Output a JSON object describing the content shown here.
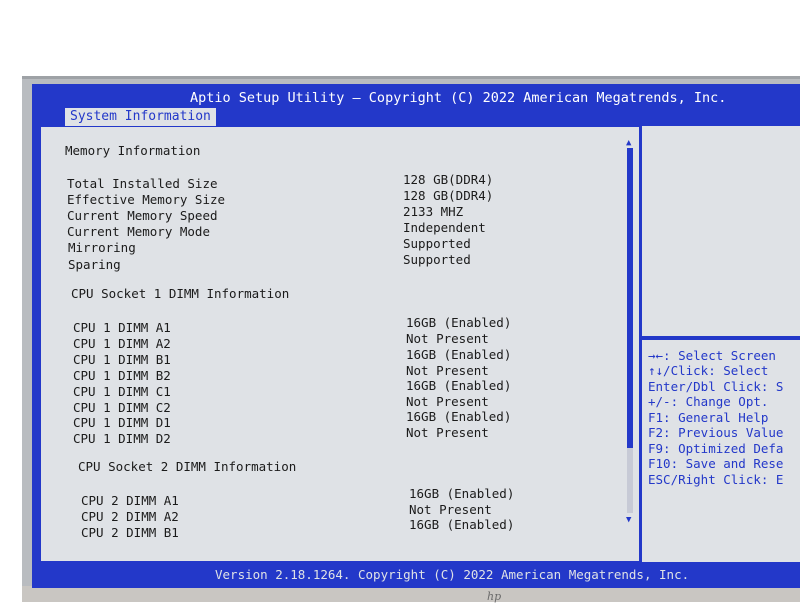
{
  "header": {
    "title": "Aptio Setup Utility – Copyright (C) 2022 American Megatrends, Inc."
  },
  "tabs": [
    {
      "label": "System Information",
      "active": true
    }
  ],
  "main": {
    "section_memory": "Memory Information",
    "memory_rows": [
      {
        "label": "Total Installed Size",
        "value": "128 GB(DDR4)"
      },
      {
        "label": "Effective Memory Size",
        "value": "128 GB(DDR4)"
      },
      {
        "label": "Current Memory Speed",
        "value": "2133 MHZ"
      },
      {
        "label": "Current Memory Mode",
        "value": "Independent"
      },
      {
        "label": "Mirroring",
        "value": "Supported"
      },
      {
        "label": "Sparing",
        "value": "Supported"
      }
    ],
    "section_socket1": "CPU Socket 1 DIMM Information",
    "socket1_rows": [
      {
        "label": "CPU 1 DIMM A1",
        "value": "16GB (Enabled)"
      },
      {
        "label": "CPU 1 DIMM A2",
        "value": "Not Present"
      },
      {
        "label": "CPU 1 DIMM B1",
        "value": "16GB (Enabled)"
      },
      {
        "label": "CPU 1 DIMM B2",
        "value": "Not Present"
      },
      {
        "label": "CPU 1 DIMM C1",
        "value": "16GB (Enabled)"
      },
      {
        "label": "CPU 1 DIMM C2",
        "value": "Not Present"
      },
      {
        "label": "CPU 1 DIMM D1",
        "value": "16GB (Enabled)"
      },
      {
        "label": "CPU 1 DIMM D2",
        "value": "Not Present"
      }
    ],
    "section_socket2": "CPU Socket 2 DIMM Information",
    "socket2_rows": [
      {
        "label": "CPU 2 DIMM A1",
        "value": "16GB (Enabled)"
      },
      {
        "label": "CPU 2 DIMM A2",
        "value": "Not Present"
      },
      {
        "label": "CPU 2 DIMM B1",
        "value": "16GB (Enabled)"
      }
    ]
  },
  "help": [
    "→←: Select Screen",
    "↑↓/Click: Select",
    "Enter/Dbl Click: S",
    "+/-: Change Opt.",
    "F1: General Help",
    "F2: Previous Value",
    "F9: Optimized Defa",
    "F10: Save and Rese",
    "ESC/Right Click: E"
  ],
  "footer": {
    "text": "Version 2.18.1264. Copyright (C) 2022 American Megatrends, Inc."
  },
  "brand": {
    "logo_text": "hp"
  },
  "colors": {
    "bios_blue": "#2338c9",
    "panel_gray": "#dfe2e6",
    "text_dark": "#1b1b1b"
  }
}
